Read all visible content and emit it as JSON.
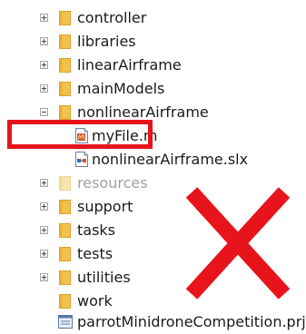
{
  "tree": {
    "items": [
      {
        "name": "controller",
        "type": "folder",
        "state": "collapsed"
      },
      {
        "name": "libraries",
        "type": "folder",
        "state": "collapsed"
      },
      {
        "name": "linearAirframe",
        "type": "folder",
        "state": "collapsed"
      },
      {
        "name": "mainModels",
        "type": "folder",
        "state": "collapsed"
      },
      {
        "name": "nonlinearAirframe",
        "type": "folder",
        "state": "expanded"
      },
      {
        "name": "myFile.m",
        "type": "m-file",
        "state": "none"
      },
      {
        "name": "nonlinearAirframe.slx",
        "type": "slx-file",
        "state": "none"
      },
      {
        "name": "resources",
        "type": "folder-muted",
        "state": "collapsed"
      },
      {
        "name": "support",
        "type": "folder",
        "state": "collapsed"
      },
      {
        "name": "tasks",
        "type": "folder",
        "state": "collapsed"
      },
      {
        "name": "tests",
        "type": "folder",
        "state": "collapsed"
      },
      {
        "name": "utilities",
        "type": "folder",
        "state": "collapsed"
      },
      {
        "name": "work",
        "type": "folder",
        "state": "none"
      },
      {
        "name": "parrotMinidroneCompetition.prj",
        "type": "prj-file",
        "state": "none"
      }
    ]
  },
  "colors": {
    "folder": "#f3c24c",
    "folder_dark": "#d9a22c",
    "folder_muted": "#f7e6b3",
    "annotation_red": "#e8141b"
  },
  "annotations": {
    "highlight_target": "myFile.m",
    "overlay_icon": "red-x-icon"
  }
}
